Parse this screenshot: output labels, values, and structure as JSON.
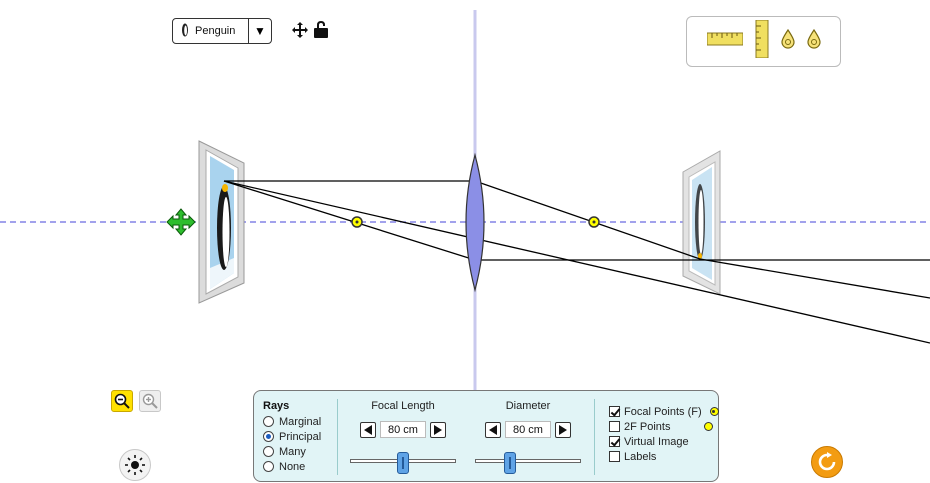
{
  "object_selector": {
    "label": "Penguin",
    "dropdown_icon": "triangle-down-icon",
    "object_icon": "penguin-icon"
  },
  "scene": {
    "move_icon": "move-arrows-icon",
    "lock_icon": "unlock-icon",
    "object_drag_icon": "four-way-arrow-icon",
    "colors": {
      "axis": "#6a6ae0",
      "lens": "#8b8fe6",
      "focal_point": "#ffff00",
      "rays": "#000000",
      "drag_handle": "#1aa31a"
    }
  },
  "toolbox": {
    "items": [
      "ruler-icon",
      "vertical-ruler-icon",
      "light-source-icon",
      "light-source-icon"
    ]
  },
  "zoom": {
    "zoom_out_icon": "zoom-out-icon",
    "zoom_in_icon": "zoom-in-icon"
  },
  "brightness_icon": "sun-icon",
  "reset_icon": "reset-icon",
  "panel": {
    "rays": {
      "title": "Rays",
      "options": [
        "Marginal",
        "Principal",
        "Many",
        "None"
      ],
      "selected": "Principal"
    },
    "focal_length": {
      "label": "Focal Length",
      "value": "80 cm",
      "slider_fraction": 0.5
    },
    "diameter": {
      "label": "Diameter",
      "value": "80 cm",
      "slider_fraction": 0.33
    },
    "checkboxes": [
      {
        "label": "Focal Points (F)",
        "checked": true
      },
      {
        "label": "2F Points",
        "checked": false
      },
      {
        "label": "Virtual Image",
        "checked": true
      },
      {
        "label": "Labels",
        "checked": false
      }
    ]
  }
}
